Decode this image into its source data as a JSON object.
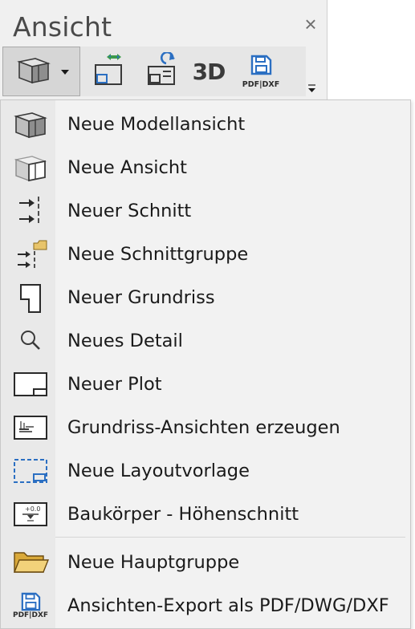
{
  "panel": {
    "title": "Ansicht",
    "close_symbol": "×"
  },
  "toolbar": {
    "buttons": [
      {
        "name": "model-view-icon"
      },
      {
        "name": "swap-view-icon"
      },
      {
        "name": "refresh-view-icon"
      },
      {
        "name": "3d-view-label",
        "label": "3D"
      },
      {
        "name": "pdf-dxf-export-icon",
        "label": "PDF|DXF"
      }
    ]
  },
  "menu": {
    "items": [
      {
        "label": "Neue Modellansicht",
        "icon": "model-view-icon"
      },
      {
        "label": "Neue Ansicht",
        "icon": "view-icon"
      },
      {
        "label": "Neuer Schnitt",
        "icon": "section-icon"
      },
      {
        "label": "Neue Schnittgruppe",
        "icon": "section-group-icon"
      },
      {
        "label": "Neuer Grundriss",
        "icon": "floorplan-icon"
      },
      {
        "label": "Neues Detail",
        "icon": "magnifier-icon"
      },
      {
        "label": "Neuer Plot",
        "icon": "plot-icon"
      },
      {
        "label": "Grundriss-Ansichten erzeugen",
        "icon": "floorplan-views-icon"
      },
      {
        "label": "Neue Layoutvorlage",
        "icon": "layout-template-icon"
      },
      {
        "label": "Baukörper - Höhenschnitt",
        "icon": "height-section-icon"
      },
      {
        "label": "Neue Hauptgruppe",
        "icon": "folder-icon"
      },
      {
        "label": "Ansichten-Export als PDF/DWG/DXF",
        "icon": "pdf-dxf-export-icon",
        "icon_text": "PDF|DXF"
      }
    ]
  },
  "colors": {
    "accent_blue": "#2b6fc2",
    "folder_yellow": "#e8c46a",
    "green": "#3b9a4b"
  }
}
